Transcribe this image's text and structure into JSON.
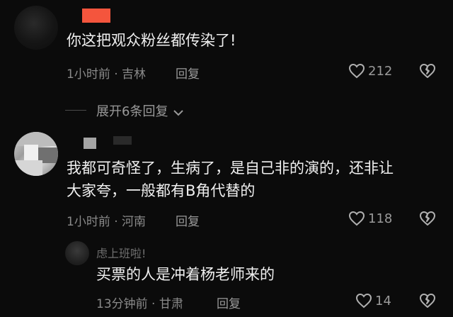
{
  "comments": [
    {
      "text": "你这把观众粉丝都传染了!",
      "time_location": "1小时前 · 吉林",
      "reply_label": "回复",
      "likes": "212"
    },
    {
      "text_line1": "我都可奇怪了，生病了，是自己非的演的，还非让",
      "text_line2": "大家夸，一般都有B角代替的",
      "time_location": "1小时前 · 河南",
      "reply_label": "回复",
      "likes": "118"
    }
  ],
  "expand_replies": "展开6条回复",
  "sub_reply": {
    "name_fragment": "虑上班啦!",
    "text": "买票的人是冲着杨老师来的",
    "time_location": "13分钟前 · 甘肃",
    "reply_label": "回复",
    "likes": "14"
  },
  "colors": {
    "background": "#0b0b0b",
    "text": "#f0f0f0",
    "meta": "#8a8a8a",
    "accent_red": "#f4553d"
  },
  "icons": [
    "heart-outline-icon",
    "broken-heart-icon",
    "chevron-down-icon"
  ]
}
